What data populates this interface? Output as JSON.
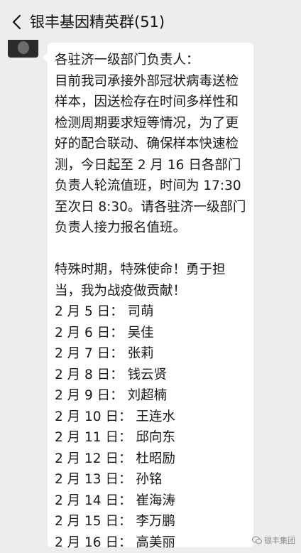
{
  "header": {
    "title": "银丰基因精英群(51)",
    "back_icon": "chevron-left-icon"
  },
  "message": {
    "paragraph1": [
      "各驻济一级部门负责人：",
      "目前我司承接外部冠状病毒送检",
      "样本，因送检存在时间多样性和",
      "检测周期要求短等情况，为了更",
      "好的配合联动、确保样本快速检",
      "测，今日起至 2 月 16 日各部门",
      "负责人轮流值班，时间为 17:30",
      "至次日 8:30。请各驻济一级部门",
      "负责人接力报名值班。"
    ],
    "paragraph2": [
      "特殊时期，特殊使命！勇于担",
      "当，我为战疫做贡献！"
    ],
    "roster": [
      "2 月 5 日： 司萌",
      "2 月 6 日： 吴佳",
      "2 月 7 日： 张莉",
      "2 月 8 日： 钱云贤",
      "2 月 9 日： 刘超楠",
      "2 月 10 日： 王连水",
      "2 月 11 日： 邱向东",
      "2 月 12 日： 杜昭励",
      "2 月 13 日： 孙铭",
      "2 月 14 日： 崔海涛",
      "2 月 15 日： 李万鹏",
      "2 月 16 日： 高美丽"
    ]
  },
  "watermark": {
    "text": "银丰集团"
  },
  "colors": {
    "background": "#ededed",
    "bubble": "#ffffff"
  }
}
